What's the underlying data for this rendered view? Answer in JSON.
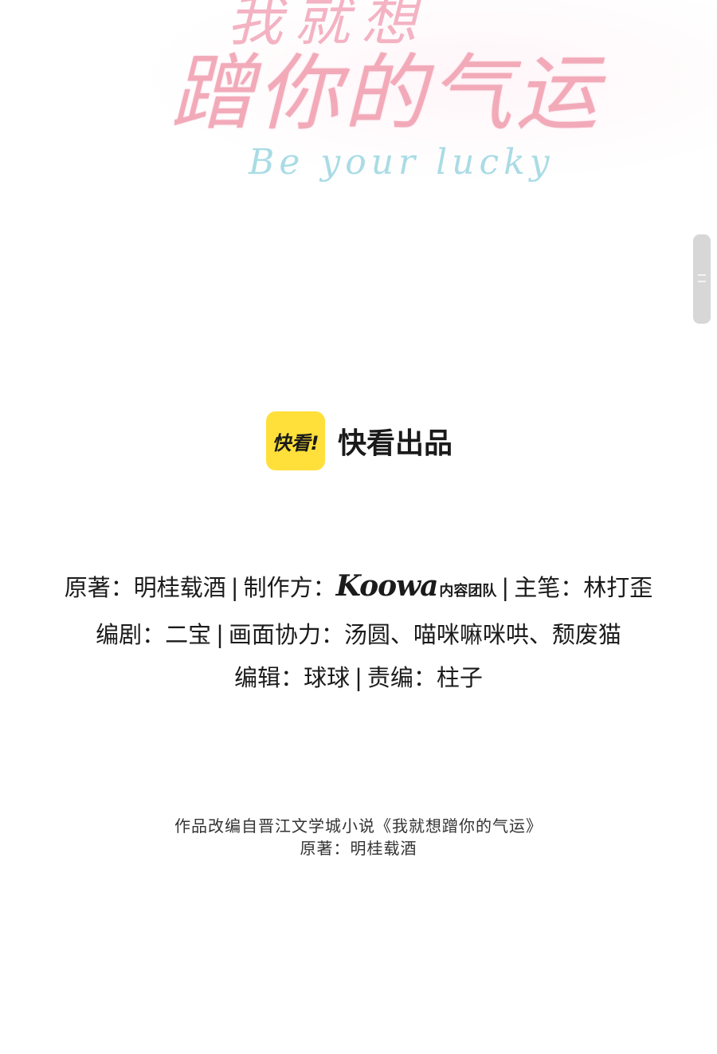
{
  "title_logo": {
    "line1": "我就想",
    "line2": "蹭你的气运",
    "subtitle": "Be your lucky"
  },
  "publisher": {
    "logo_text": "快看!",
    "text": "快看出品",
    "logo_color": "#ffe03a"
  },
  "credits": {
    "line1": {
      "author_label": "原著：",
      "author": "明桂载酒",
      "sep": "|",
      "producer_label": "制作方：",
      "producer_brand": "Koowa",
      "producer_team": "内容团队",
      "lead_label": "主笔：",
      "lead": "林打歪"
    },
    "line2": {
      "writer_label": "编剧：",
      "writer": "二宝",
      "sep": "|",
      "assist_label": "画面协力：",
      "assist": "汤圆、喵咪嘛咪哄、颓废猫"
    },
    "line3": {
      "editor_label": "编辑：",
      "editor": "球球",
      "sep": "|",
      "chief_editor_label": "责编：",
      "chief_editor": "柱子"
    }
  },
  "adaptation_note": {
    "line1": "作品改编自晋江文学城小说《我就想蹭你的气运》",
    "line2": "原著：明桂载酒"
  }
}
